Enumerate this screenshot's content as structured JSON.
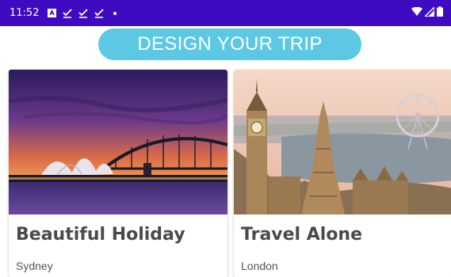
{
  "status_bar": {
    "time": "11:52",
    "icons_left": [
      "notification-a-icon",
      "check-download-icon",
      "check-download-icon",
      "check-download-icon",
      "dot-icon"
    ],
    "icons_right": [
      "wifi-icon",
      "signal-icon",
      "battery-icon"
    ]
  },
  "header": {
    "title": "DESIGN YOUR TRIP"
  },
  "cards": [
    {
      "title": "Beautiful Holiday",
      "subtitle": "Sydney"
    },
    {
      "title": "Travel Alone",
      "subtitle": "London"
    }
  ],
  "colors": {
    "status_bar": "#3f0bc0",
    "pill": "#5cc8e4",
    "card_title": "#4a4a4a"
  }
}
